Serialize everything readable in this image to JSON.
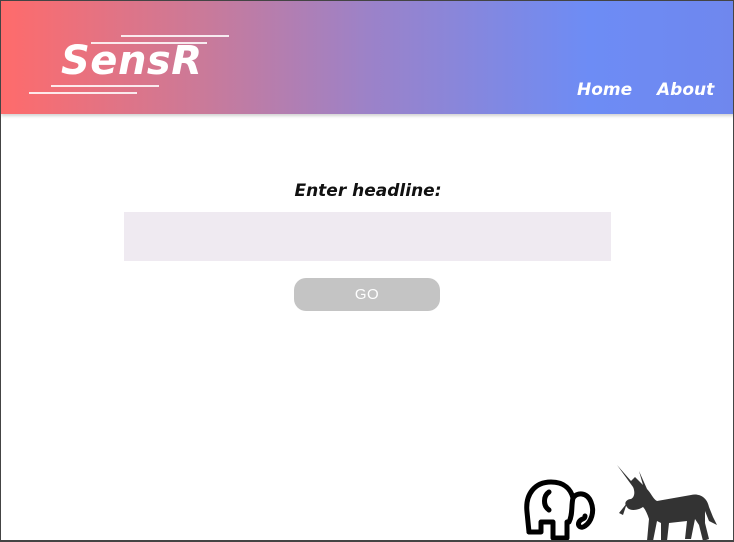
{
  "header": {
    "logo_text": "SensR",
    "nav": [
      {
        "label": "Home"
      },
      {
        "label": "About"
      }
    ]
  },
  "main": {
    "prompt_label": "Enter headline:",
    "headline_input": {
      "value": "",
      "placeholder": ""
    },
    "go_label": "GO"
  },
  "icons": {
    "elephant": "elephant-icon",
    "donkey": "donkey-icon"
  },
  "colors": {
    "header_gradient_start": "#ff6b6b",
    "header_gradient_end": "#6d8cf5",
    "input_bg": "#efeaf1",
    "button_bg": "#c4c4c4"
  }
}
